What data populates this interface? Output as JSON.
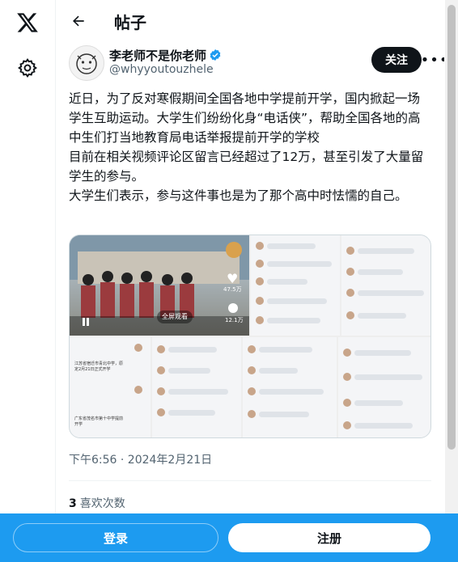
{
  "header": {
    "title": "帖子"
  },
  "author": {
    "name": "李老师不是你老师",
    "handle": "@whyyoutouzhele",
    "follow_label": "关注"
  },
  "tweet": {
    "text": "近日，为了反对寒假期间全国各地中学提前开学，国内掀起一场学生互助运动。大学生们纷纷化身“电话侠”，帮助全国各地的高中生们打当地教育局电话举报提前开学的学校\n目前在相关视频评论区留言已经超过了12万，甚至引发了大量留学生的参与。\n大学生们表示，参与这件事也是为了那个高中时怯懦的自己。",
    "timestamp": "下午6:56 · 2024年2月21日",
    "likes_count": "3",
    "likes_label": "喜欢次数"
  },
  "media": {
    "video_like_count": "47.5万",
    "video_share_count": "12.1万",
    "video_fullscreen_label": "全屏观看",
    "chat_snippet_1": "江苏省宿迁市青北中学，原定2月21日正式开学",
    "chat_snippet_2": "广东省茂名市第十中学提前开学"
  },
  "footer": {
    "login_label": "登录",
    "signup_label": "注册"
  },
  "colors": {
    "brand": "#1d9bf0",
    "text": "#0f1419",
    "muted": "#536471"
  }
}
